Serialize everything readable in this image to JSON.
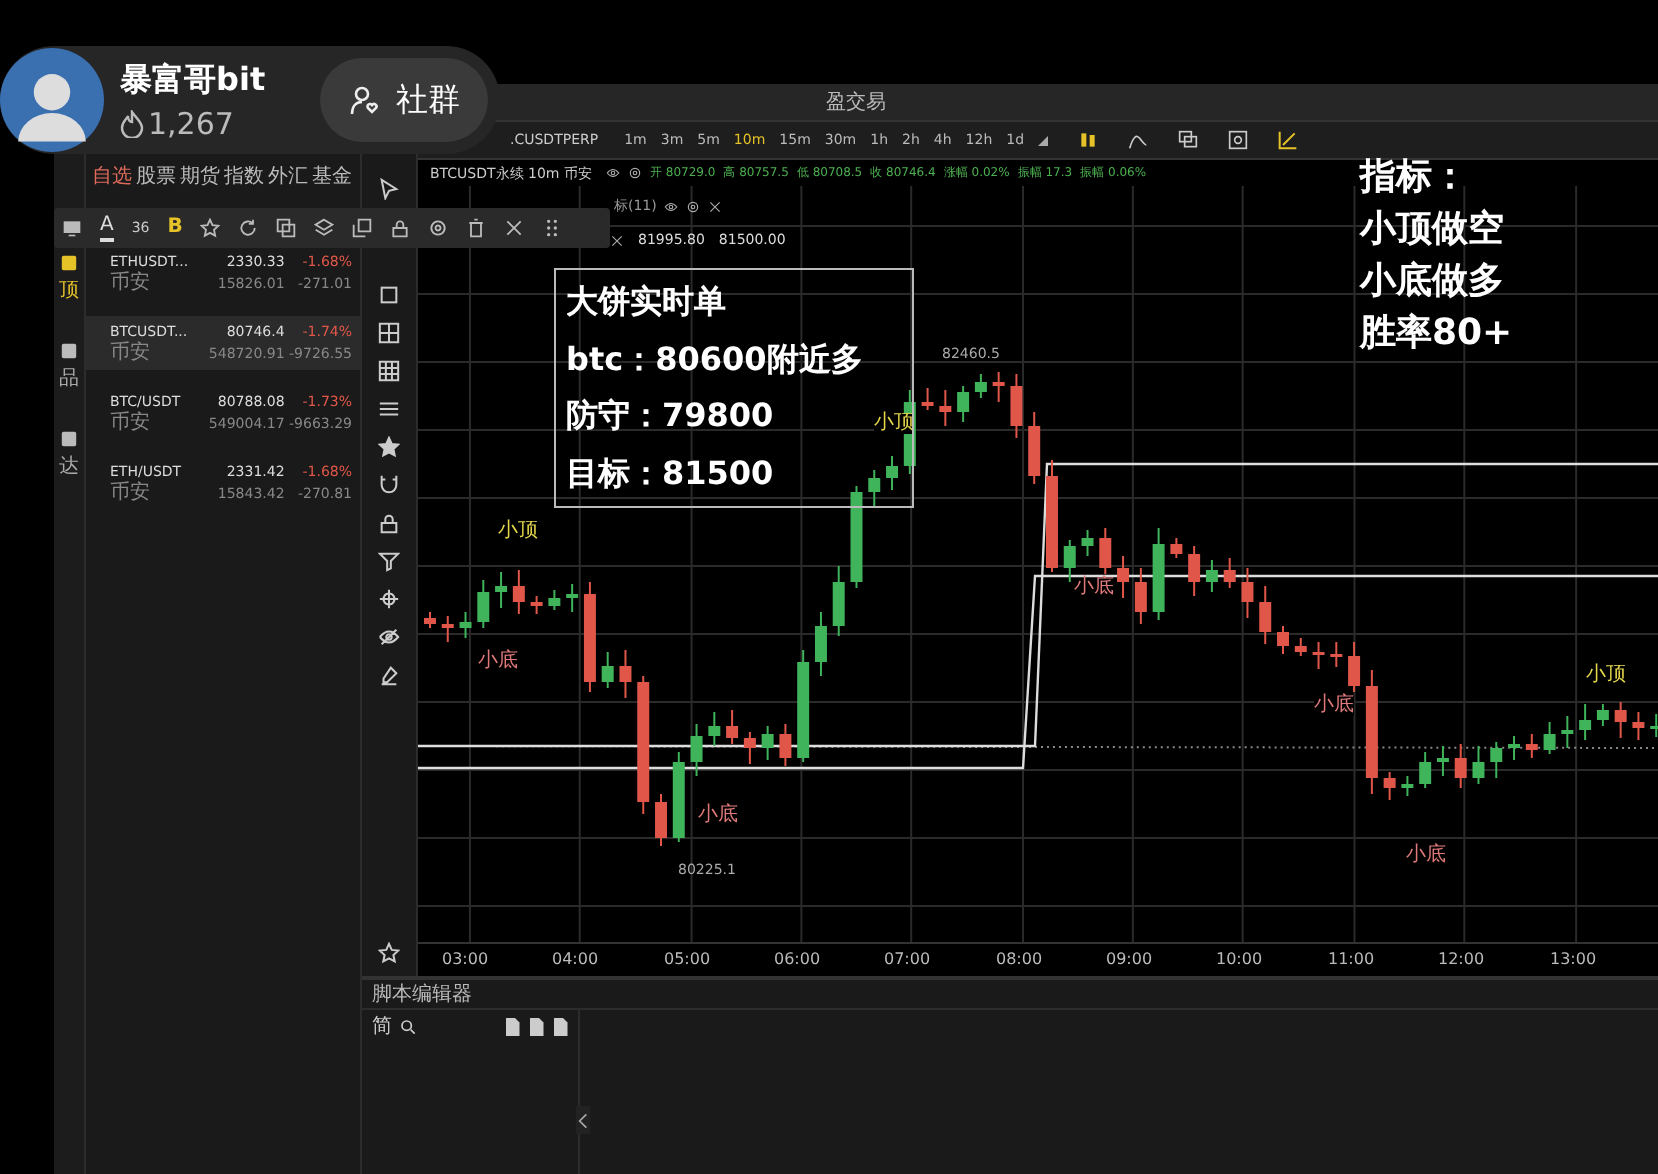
{
  "stream_overlay": {
    "streamer_name": "暴富哥bit",
    "likes": "1,267",
    "community_button": "社群"
  },
  "window": {
    "title": "盈交易"
  },
  "nav_rail": {
    "labels": [
      "顶",
      "品",
      "达"
    ]
  },
  "watchlist": {
    "tabs": [
      {
        "label": "自选",
        "selected": true
      },
      {
        "label": "股票",
        "selected": false
      },
      {
        "label": "期货",
        "selected": false
      },
      {
        "label": "指数",
        "selected": false
      },
      {
        "label": "外汇",
        "selected": false
      },
      {
        "label": "基金",
        "selected": false
      }
    ],
    "rows": [
      {
        "symbol": "ETHUSDT...",
        "exchange": "币安",
        "price": "2330.33",
        "volume": "15826.01",
        "change_pct": "-1.68%",
        "change": "-271.01",
        "selected": false
      },
      {
        "symbol": "BTCUSDT...",
        "exchange": "币安",
        "price": "80746.4",
        "volume": "548720.91",
        "change_pct": "-1.74%",
        "change": "-9726.55",
        "selected": true
      },
      {
        "symbol": "BTC/USDT",
        "exchange": "币安",
        "price": "80788.08",
        "volume": "549004.17",
        "change_pct": "-1.73%",
        "change": "-9663.29",
        "selected": false
      },
      {
        "symbol": "ETH/USDT",
        "exchange": "币安",
        "price": "2331.42",
        "volume": "15843.42",
        "change_pct": "-1.68%",
        "change": "-270.81",
        "selected": false
      }
    ]
  },
  "drawing_toolbar": {
    "text_color_glyph": "A",
    "font_size": "36",
    "bold_glyph": "B"
  },
  "chart": {
    "symbol_field": ".CUSDTPERP",
    "intervals": [
      {
        "label": "1m",
        "selected": false
      },
      {
        "label": "3m",
        "selected": false
      },
      {
        "label": "5m",
        "selected": false
      },
      {
        "label": "10m",
        "selected": true
      },
      {
        "label": "15m",
        "selected": false
      },
      {
        "label": "30m",
        "selected": false
      },
      {
        "label": "1h",
        "selected": false
      },
      {
        "label": "2h",
        "selected": false
      },
      {
        "label": "4h",
        "selected": false
      },
      {
        "label": "12h",
        "selected": false
      },
      {
        "label": "1d",
        "selected": false
      }
    ],
    "legend_title": "BTCUSDT永续 10m 币安",
    "legend_values": [
      {
        "label": "开",
        "value": "80729.0"
      },
      {
        "label": "高",
        "value": "80757.5"
      },
      {
        "label": "低",
        "value": "80708.5"
      },
      {
        "label": "收",
        "value": "80746.4"
      },
      {
        "label": "涨幅",
        "value": "0.02%"
      },
      {
        "label": "振幅",
        "value": "17.3"
      },
      {
        "label": "振幅",
        "value": "0.06%"
      }
    ],
    "indicator_label": "标(11)",
    "indicator_values": [
      "81995.80",
      "81500.00"
    ],
    "markers": [
      {
        "kind": "top",
        "text": "小顶"
      },
      {
        "kind": "bottom",
        "text": "小底"
      },
      {
        "kind": "top",
        "text": "小顶"
      },
      {
        "kind": "bottom",
        "text": "小底"
      },
      {
        "kind": "bottom",
        "text": "小底"
      },
      {
        "kind": "bottom",
        "text": "小底"
      },
      {
        "kind": "bottom",
        "text": "小底"
      },
      {
        "kind": "top",
        "text": "小顶"
      }
    ],
    "price_labels": [
      "82460.5",
      "80225.1"
    ],
    "time_labels": [
      "03:00",
      "04:00",
      "05:00",
      "06:00",
      "07:00",
      "08:00",
      "09:00",
      "10:00",
      "11:00",
      "12:00",
      "13:00"
    ]
  },
  "signal_box": {
    "lines": [
      "大饼实时单",
      "btc：80600附近多",
      "防守：79800",
      "目标：81500"
    ]
  },
  "strategy_note": {
    "lines": [
      "指标：",
      "小顶做空",
      "小底做多",
      "胜率80+"
    ]
  },
  "script_editor": {
    "title": "脚本编辑器",
    "filter_glyph": "简"
  }
}
